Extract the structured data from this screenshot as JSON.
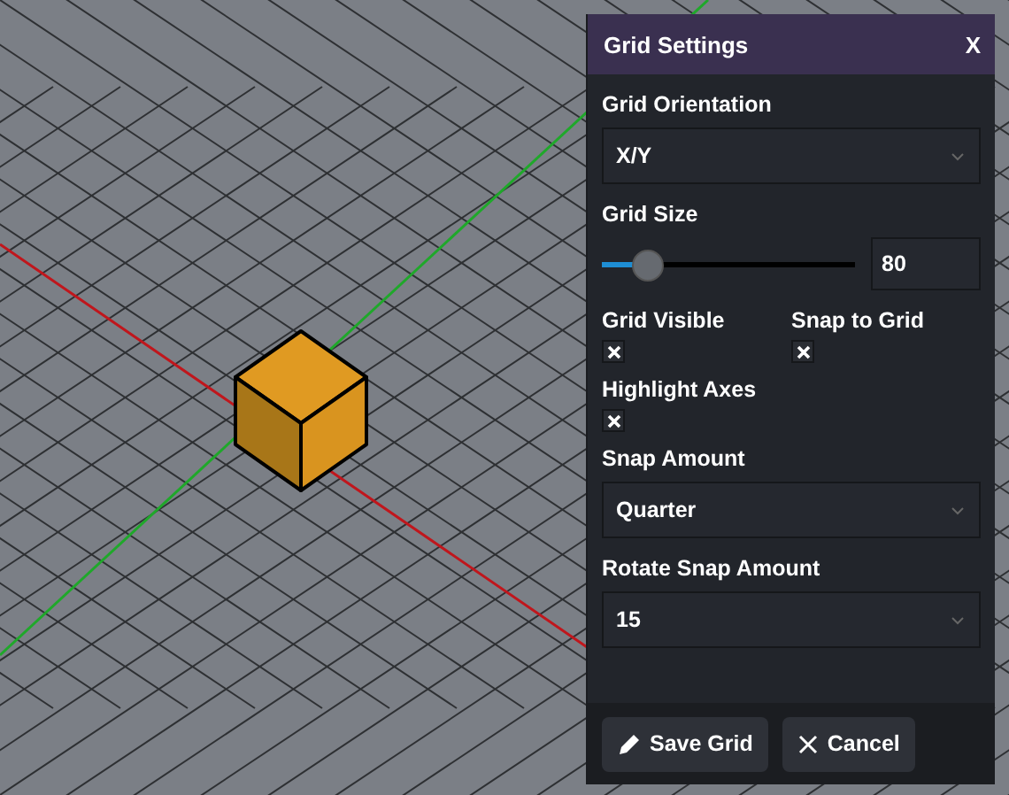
{
  "dialog": {
    "title": "Grid Settings",
    "close": "X"
  },
  "fields": [
    {
      "kind": "select",
      "label": "Grid Orientation",
      "value": "X/Y"
    },
    {
      "kind": "slider",
      "label": "Grid Size",
      "level": 0.19,
      "value": "80"
    },
    {
      "kind": "checks",
      "items": [
        {
          "label": "Grid Visible",
          "checked": true
        },
        {
          "label": "Snap to Grid",
          "checked": true
        }
      ]
    },
    {
      "kind": "checks",
      "items": [
        {
          "label": "Highlight Axes",
          "checked": true
        }
      ]
    },
    {
      "kind": "select",
      "label": "Snap Amount",
      "value": "Quarter"
    },
    {
      "kind": "select",
      "label": "Rotate Snap Amount",
      "value": "15"
    }
  ],
  "buttons": [
    {
      "kind": "save",
      "label": "Save Grid"
    },
    {
      "kind": "cancel",
      "label": "Cancel"
    }
  ]
}
